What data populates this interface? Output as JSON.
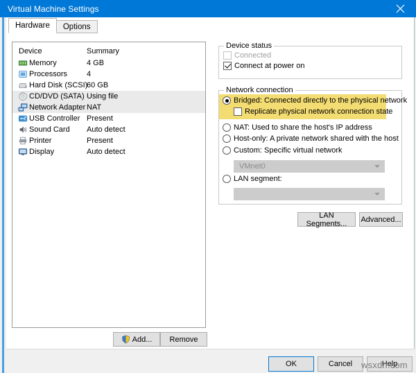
{
  "window": {
    "title": "Virtual Machine Settings",
    "close_icon": "close-icon"
  },
  "tabs": [
    {
      "label": "Hardware",
      "active": true
    },
    {
      "label": "Options",
      "active": false
    }
  ],
  "device_list": {
    "columns": [
      "Device",
      "Summary"
    ],
    "rows": [
      {
        "icon": "memory-icon",
        "device": "Memory",
        "summary": "4 GB",
        "selected": false
      },
      {
        "icon": "processor-icon",
        "device": "Processors",
        "summary": "4",
        "selected": false
      },
      {
        "icon": "hard-disk-icon",
        "device": "Hard Disk (SCSI)",
        "summary": "60 GB",
        "selected": false
      },
      {
        "icon": "cd-dvd-icon",
        "device": "CD/DVD (SATA)",
        "summary": "Using file",
        "selected": true
      },
      {
        "icon": "network-adapter-icon",
        "device": "Network Adapter",
        "summary": "NAT",
        "selected": true
      },
      {
        "icon": "usb-controller-icon",
        "device": "USB Controller",
        "summary": "Present",
        "selected": false
      },
      {
        "icon": "sound-card-icon",
        "device": "Sound Card",
        "summary": "Auto detect",
        "selected": false
      },
      {
        "icon": "printer-icon",
        "device": "Printer",
        "summary": "Present",
        "selected": false
      },
      {
        "icon": "display-icon",
        "device": "Display",
        "summary": "Auto detect",
        "selected": false
      }
    ]
  },
  "device_buttons": {
    "add_label": "Add...",
    "remove_label": "Remove",
    "add_icon": "uac-shield-icon"
  },
  "device_status": {
    "title": "Device status",
    "connected": {
      "label": "Connected",
      "checked": false,
      "disabled": true
    },
    "connect_at_power_on": {
      "label": "Connect at power on",
      "checked": true,
      "disabled": false
    }
  },
  "network_connection": {
    "title": "Network connection",
    "options": [
      {
        "label": "Bridged: Connected directly to the physical network",
        "selected": true,
        "highlighted": true
      },
      {
        "label": "NAT: Used to share the host's IP address",
        "selected": false,
        "highlighted": false
      },
      {
        "label": "Host-only: A private network shared with the host",
        "selected": false,
        "highlighted": false
      },
      {
        "label": "Custom: Specific virtual network",
        "selected": false,
        "highlighted": false
      },
      {
        "label": "LAN segment:",
        "selected": false,
        "highlighted": false
      }
    ],
    "replicate": {
      "label": "Replicate physical network connection state",
      "checked": false
    },
    "custom_network_value": "VMnet0",
    "lan_segment_value": "",
    "highlight_color": "#f3dc72"
  },
  "network_buttons": {
    "lan_segments_label": "LAN Segments...",
    "advanced_label": "Advanced..."
  },
  "footer": {
    "ok_label": "OK",
    "cancel_label": "Cancel",
    "help_label": "Help"
  },
  "watermark": {
    "text": "wsxdn.com"
  },
  "theme": {
    "title_bar": "#0078d7",
    "accent": "#4a9fe0",
    "highlight_yellow": "#f3dc72",
    "selection_grey": "#eaeaea"
  }
}
